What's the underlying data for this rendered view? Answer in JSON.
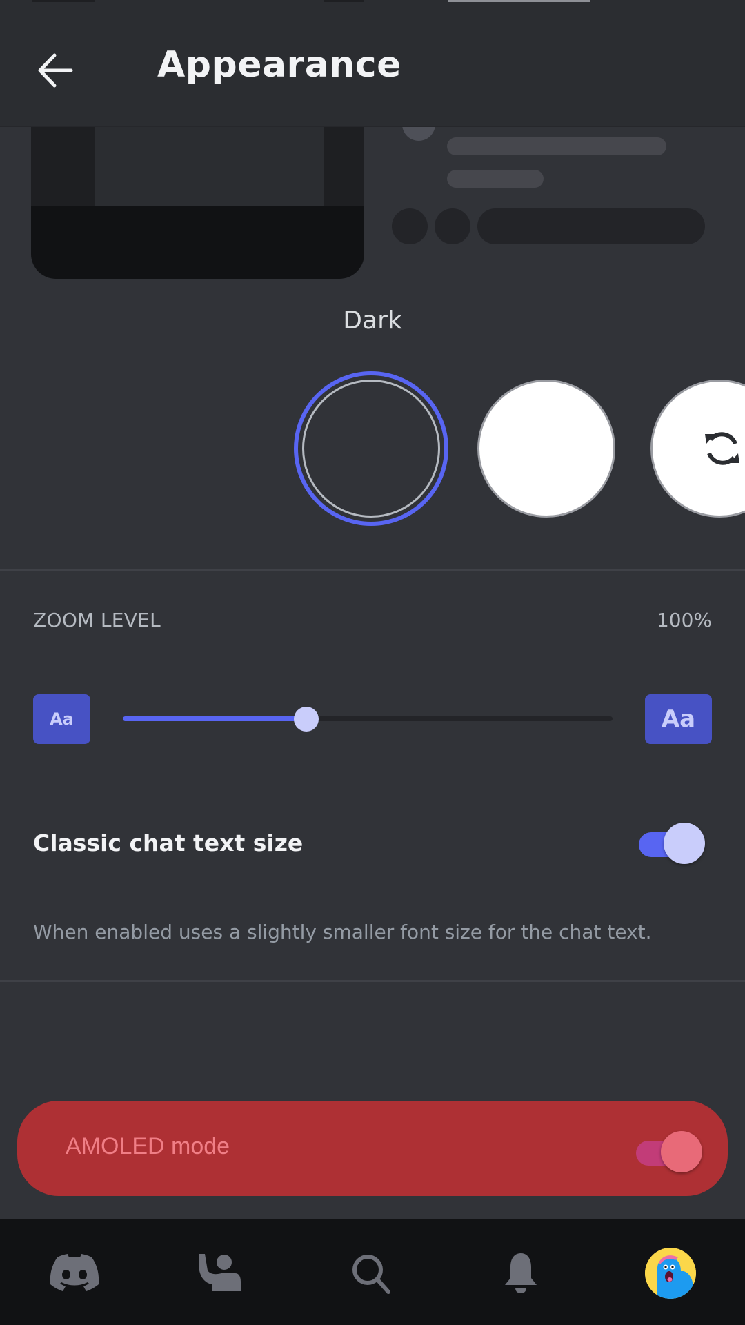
{
  "header": {
    "title": "Appearance",
    "back_icon": "arrow-left-icon"
  },
  "theme": {
    "selected_name": "Dark",
    "options": [
      {
        "id": "dark",
        "color": "#313338",
        "selected": true
      },
      {
        "id": "light",
        "color": "#ffffff",
        "selected": false
      },
      {
        "id": "sync",
        "color": "#ffffff",
        "icon": "sync-icon",
        "selected": false
      }
    ],
    "accent": "#5865f2"
  },
  "zoom": {
    "label": "ZOOM LEVEL",
    "value_text": "100%",
    "small_button": "Aa",
    "large_button": "Aa",
    "slider_fraction": 0.375
  },
  "classic_text": {
    "title": "Classic chat text size",
    "description": "When enabled uses a slightly smaller font size for the chat text.",
    "enabled": true
  },
  "amoled": {
    "label": "AMOLED mode",
    "enabled": true,
    "banner_color": "#ae3034"
  },
  "bottom_nav": {
    "items": [
      {
        "name": "home",
        "icon": "discord-logo-icon"
      },
      {
        "name": "friends",
        "icon": "friends-wave-icon"
      },
      {
        "name": "search",
        "icon": "search-icon"
      },
      {
        "name": "notifications",
        "icon": "bell-icon"
      },
      {
        "name": "profile",
        "icon": "avatar"
      }
    ]
  }
}
